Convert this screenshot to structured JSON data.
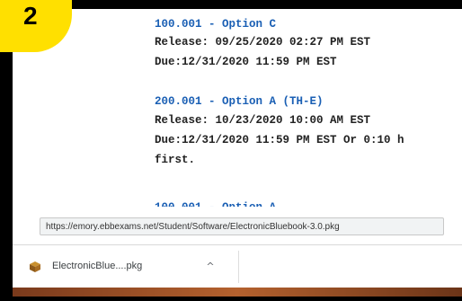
{
  "colors": {
    "link": "#1a5fb4",
    "badge": "#ffe000",
    "frame_border": "#000000"
  },
  "badge": {
    "step": "2"
  },
  "assignments": {
    "lines": [
      {
        "kind": "link",
        "text": "100.001 - Option C"
      },
      {
        "kind": "plain",
        "text": "Release: 09/25/2020 02:27 PM EST"
      },
      {
        "kind": "plain",
        "text": "Due:12/31/2020 11:59 PM EST"
      },
      {
        "kind": "link",
        "text": "200.001 - Option A (TH-E)"
      },
      {
        "kind": "plain",
        "text": "Release: 10/23/2020 10:00 AM EST"
      },
      {
        "kind": "plain",
        "text": "Due:12/31/2020 11:59 PM EST Or 0:10 h"
      },
      {
        "kind": "plain",
        "text": "first."
      }
    ],
    "cutoff_text": "100.001 - Option A"
  },
  "status": {
    "url": "https://emory.ebbexams.net/Student/Software/ElectronicBluebook-3.0.pkg"
  },
  "downloads": {
    "file_name": "ElectronicBlue....pkg",
    "file_icon": "package-icon",
    "menu_icon": "chevron-up-icon",
    "chevron_glyph": "^"
  }
}
